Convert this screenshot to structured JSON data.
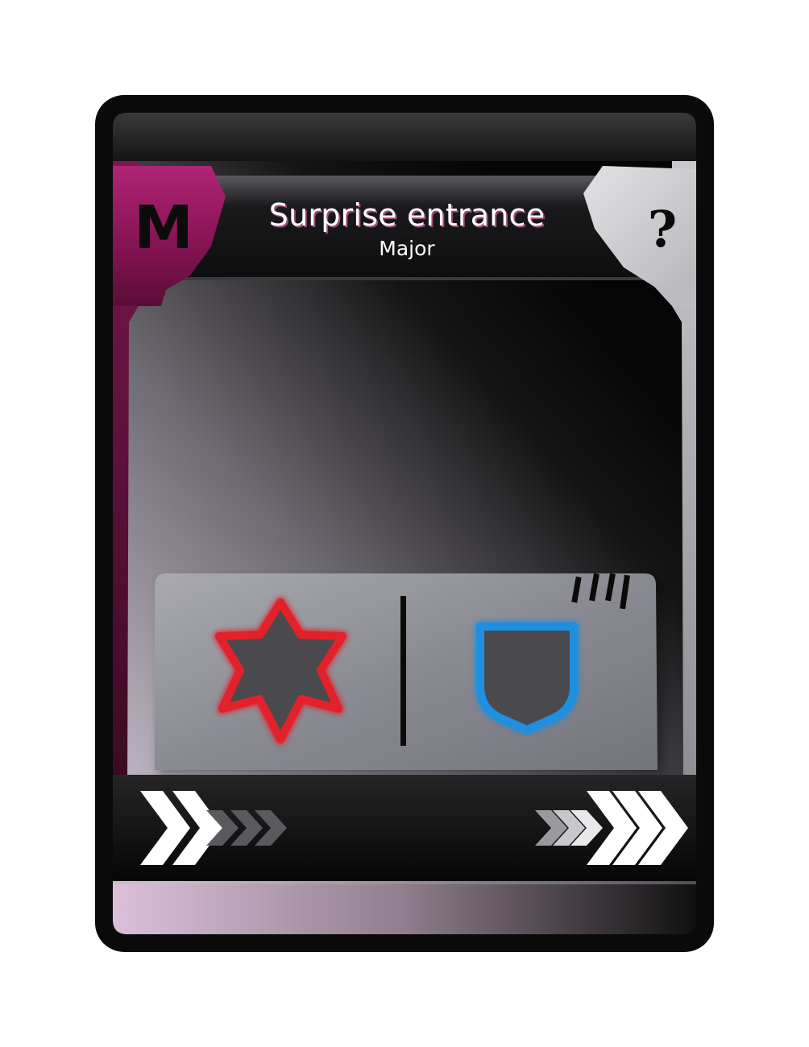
{
  "card": {
    "title": "Surprise entrance",
    "subtitle": "Major",
    "rank_letter": "M",
    "cost_symbol": "?"
  },
  "colors": {
    "frame": "#0a0a0a",
    "rank_accent": "#a01e66",
    "cost_panel": "#d4d4d6",
    "attack_outline": "#e3212b",
    "defense_outline": "#1f8fe0",
    "bottom_gradient_start": "#d9b9d6"
  },
  "icons": {
    "attack": "six-point-star-icon",
    "defense": "shield-icon",
    "left_arrows": "chevron-right-icon",
    "right_arrows": "chevron-right-icon"
  }
}
